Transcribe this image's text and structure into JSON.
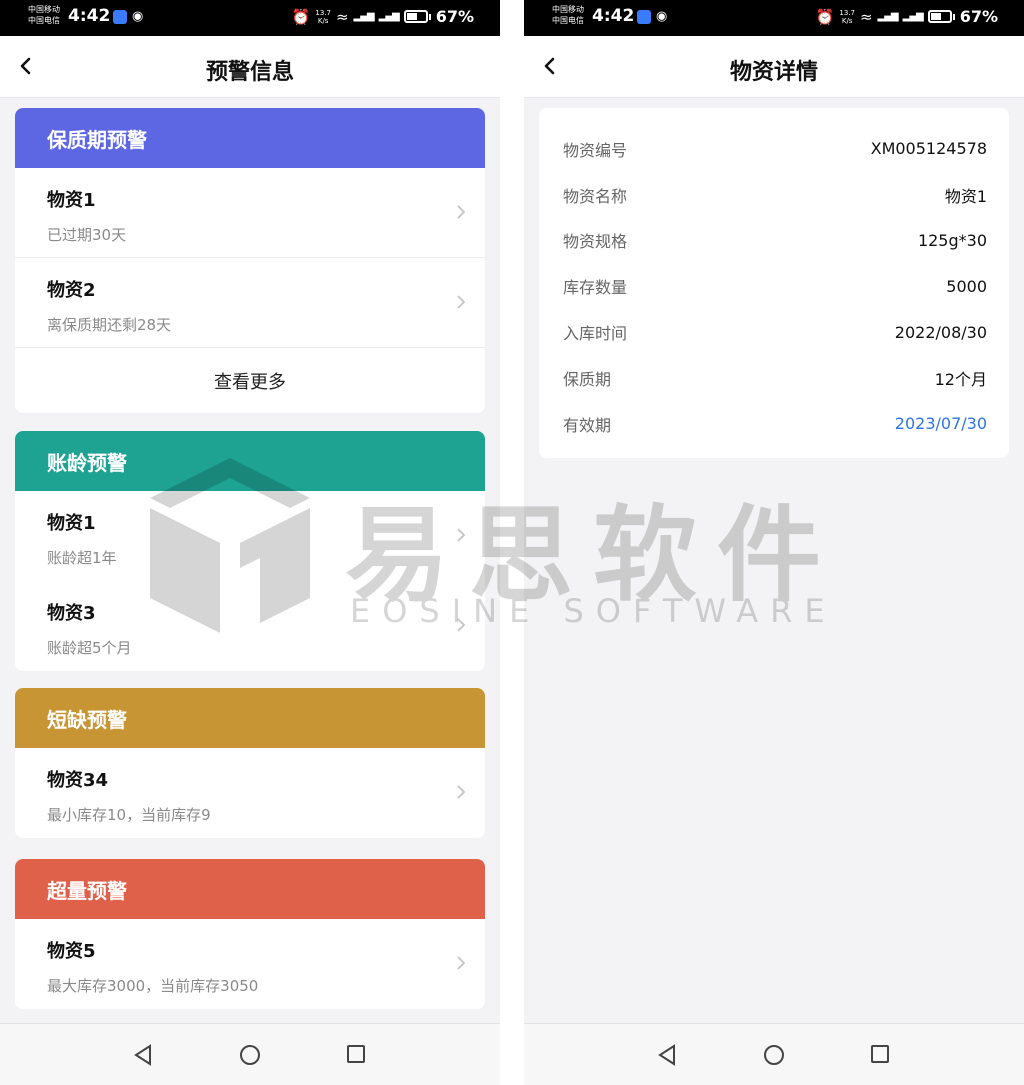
{
  "status_bar": {
    "carrier_line1": "中国移动",
    "carrier_line2": "中国电信",
    "time": "4:42",
    "alarm_icon": "alarm-icon",
    "speed_top": "13.7",
    "speed_bottom": "K/s",
    "wifi_icon": "wifi-icon",
    "battery_percent": "67%"
  },
  "left_screen": {
    "title": "预警信息",
    "sections": [
      {
        "title": "保质期预警",
        "color": "#5d67e3",
        "items": [
          {
            "name": "物资1",
            "desc": "已过期30天"
          },
          {
            "name": "物资2",
            "desc": "离保质期还剩28天"
          }
        ],
        "more_label": "查看更多"
      },
      {
        "title": "账龄预警",
        "color": "#1ea393",
        "items": [
          {
            "name": "物资1",
            "desc": "账龄超1年"
          },
          {
            "name": "物资3",
            "desc": "账龄超5个月"
          }
        ]
      },
      {
        "title": "短缺预警",
        "color": "#c89535",
        "items": [
          {
            "name": "物资34",
            "desc": "最小库存10，当前库存9"
          }
        ]
      },
      {
        "title": "超量预警",
        "color": "#e0614a",
        "items": [
          {
            "name": "物资5",
            "desc": "最大库存3000，当前库存3050"
          }
        ]
      }
    ]
  },
  "right_screen": {
    "title": "物资详情",
    "rows": [
      {
        "label": "物资编号",
        "value": "XM005124578"
      },
      {
        "label": "物资名称",
        "value": "物资1"
      },
      {
        "label": "物资规格",
        "value": "125g*30"
      },
      {
        "label": "库存数量",
        "value": "5000"
      },
      {
        "label": "入库时间",
        "value": "2022/08/30"
      },
      {
        "label": "保质期",
        "value": "12个月"
      },
      {
        "label": "有效期",
        "value": "2023/07/30",
        "highlight_color": "#2f73e6"
      }
    ]
  },
  "watermark": {
    "text_cn": "易思软件",
    "text_en": "EOSINE SOFTWARE"
  },
  "bottom_nav": {
    "back_icon": "triangle-back-icon",
    "home_icon": "circle-home-icon",
    "recent_icon": "square-recent-icon"
  }
}
